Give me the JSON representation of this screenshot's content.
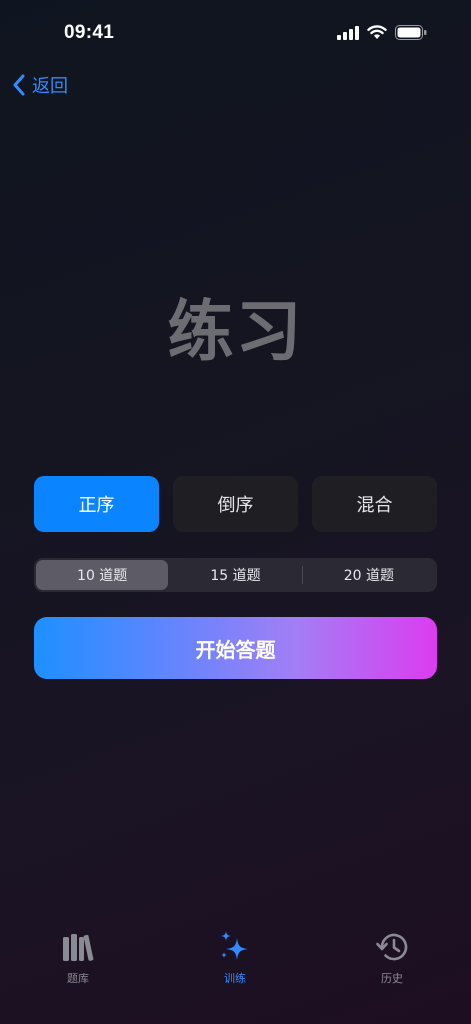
{
  "status_bar": {
    "time": "09:41"
  },
  "nav": {
    "back_label": "返回"
  },
  "page": {
    "title": "练习"
  },
  "order_modes": [
    {
      "label": "正序",
      "selected": true
    },
    {
      "label": "倒序",
      "selected": false
    },
    {
      "label": "混合",
      "selected": false
    }
  ],
  "question_count": [
    {
      "label": "10 道题",
      "selected": true
    },
    {
      "label": "15 道题",
      "selected": false
    },
    {
      "label": "20 道题",
      "selected": false
    }
  ],
  "start_button": {
    "label": "开始答题"
  },
  "tab_bar": [
    {
      "label": "题库",
      "icon": "books-icon",
      "active": false
    },
    {
      "label": "训练",
      "icon": "sparkles-icon",
      "active": true
    },
    {
      "label": "历史",
      "icon": "history-clock-icon",
      "active": false
    }
  ],
  "colors": {
    "accent": "#0a84ff",
    "start_gradient_from": "#1e90ff",
    "start_gradient_to": "#dc3cf0",
    "title_gray": "#6c6c72"
  }
}
